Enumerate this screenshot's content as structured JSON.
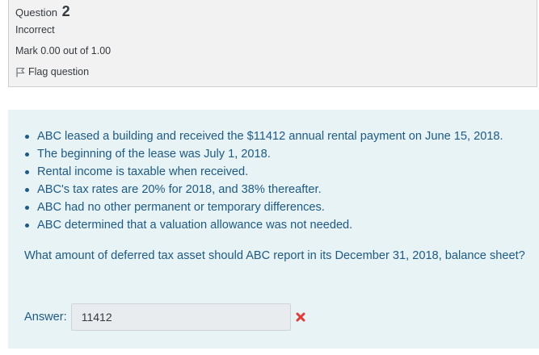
{
  "info": {
    "question_label": "Question",
    "question_number": "2",
    "state": "Incorrect",
    "grade": "Mark 0.00 out of 1.00",
    "flag_label": "Flag question",
    "flag_icon": "flag-icon"
  },
  "question": {
    "points": [
      "ABC leased a building and received the $11412 annual rental payment on June 15, 2018.",
      "The beginning of the lease was July 1, 2018.",
      "Rental income is taxable when received.",
      "ABC's tax rates are 20% for 2018, and 38% thereafter.",
      "ABC had no other permanent or temporary differences.",
      "ABC determined that a valuation allowance was not needed."
    ],
    "prompt": "What amount of deferred tax asset should ABC report in its December 31, 2018, balance sheet?"
  },
  "answer": {
    "label": "Answer:",
    "value": "11412",
    "status_icon": "incorrect-icon",
    "status_color": "#e53935"
  },
  "colors": {
    "info_bg": "#f2f2f2",
    "content_bg": "#e7f3f5",
    "text_blue": "#1d5a86"
  }
}
